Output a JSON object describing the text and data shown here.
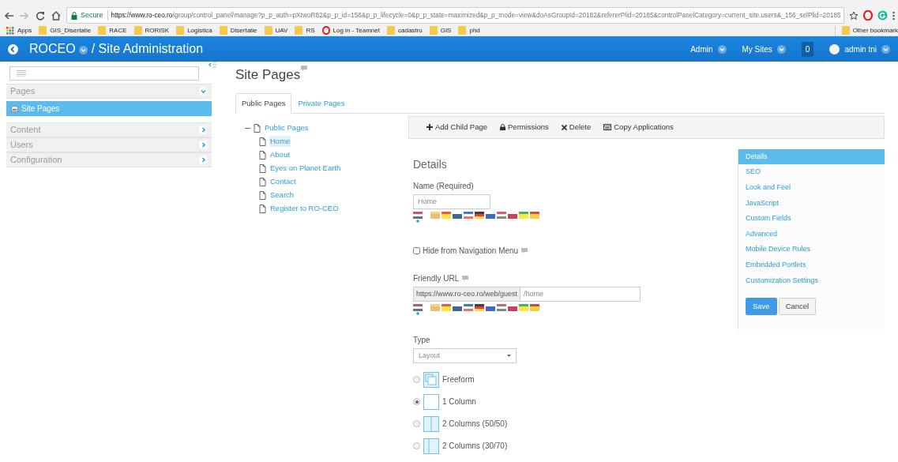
{
  "browser": {
    "nav": [
      {
        "kind": "back",
        "disabled": false
      },
      {
        "kind": "forward",
        "disabled": true
      },
      {
        "kind": "reload",
        "disabled": false
      },
      {
        "kind": "home",
        "disabled": false
      }
    ],
    "security": "Secure",
    "url_host": "https://www.ro-ceo.ro",
    "url_path": "/group/control_panel/manage?p_p_auth=pXtwoR82&p_p_id=156&p_p_lifecycle=0&p_p_state=maximized&p_p_mode=view&doAsGroupId=20182&refererPlid=20185&controlPanelCategory=current_site.users&_156_selPlid=20185",
    "bookmarks": [
      {
        "label": "Apps",
        "kind": "apps"
      },
      {
        "label": "GIS_Disertatie",
        "kind": "folder"
      },
      {
        "label": "RACE",
        "kind": "folder"
      },
      {
        "label": "RORISK",
        "kind": "folder"
      },
      {
        "label": "Logistica",
        "kind": "folder"
      },
      {
        "label": "Disertatie",
        "kind": "folder"
      },
      {
        "label": "UAV",
        "kind": "folder"
      },
      {
        "label": "RS",
        "kind": "folder"
      },
      {
        "label": "Log in - Teamnet",
        "kind": "opera"
      },
      {
        "label": "cadastru",
        "kind": "folder"
      },
      {
        "label": "GIS",
        "kind": "folder"
      },
      {
        "label": "phd",
        "kind": "folder"
      }
    ],
    "other_bookmarks": "Other bookmark"
  },
  "header": {
    "site": "ROCEO",
    "title": "/ Site Administration",
    "menus": [
      {
        "label": "Admin",
        "kind": "menu"
      },
      {
        "label": "My Sites",
        "kind": "menu"
      },
      {
        "label": "0",
        "kind": "count"
      },
      {
        "label": "admin tni",
        "kind": "user"
      }
    ]
  },
  "sidebar": {
    "panels": [
      {
        "label": "Pages",
        "expanded": true,
        "items": [
          {
            "label": "Site Pages",
            "selected": true
          }
        ]
      },
      {
        "label": "Content",
        "expanded": false
      },
      {
        "label": "Users",
        "expanded": false
      },
      {
        "label": "Configuration",
        "expanded": false
      }
    ]
  },
  "page": {
    "title": "Site Pages",
    "tabs": [
      {
        "label": "Public Pages",
        "selected": true
      },
      {
        "label": "Private Pages",
        "selected": false
      }
    ],
    "tree": {
      "label": "Public Pages",
      "expanded": true,
      "children": [
        {
          "label": "Home",
          "selected": true
        },
        {
          "label": "About",
          "selected": false
        },
        {
          "label": "Eyes on Planet Earth",
          "selected": false
        },
        {
          "label": "Contact",
          "selected": false
        },
        {
          "label": "Search",
          "selected": false
        },
        {
          "label": "Register to RO-CEO",
          "selected": false
        }
      ]
    },
    "toolbar": [
      {
        "label": "Add Child Page",
        "kind": "add"
      },
      {
        "label": "Permissions",
        "kind": "lock"
      },
      {
        "label": "Delete",
        "kind": "delete"
      },
      {
        "label": "Copy Applications",
        "kind": "copy"
      }
    ],
    "form": {
      "heading": "Details",
      "name_label": "Name (Required)",
      "name_value": "Home",
      "name_languages": [
        {
          "selected": true
        },
        {
          "selected": false
        },
        {
          "selected": false
        },
        {
          "selected": false
        },
        {
          "selected": false
        },
        {
          "selected": false
        },
        {
          "selected": false
        },
        {
          "selected": false
        },
        {
          "selected": false
        },
        {
          "selected": false
        },
        {
          "selected": false
        }
      ],
      "hide_label": "Hide from Navigation Menu",
      "hide_checked": false,
      "url_label": "Friendly URL",
      "url_prefix": "https://www.ro-ceo.ro/web/guest",
      "url_value": "/home",
      "url_languages": [
        {
          "selected": true
        },
        {
          "selected": false
        },
        {
          "selected": false
        },
        {
          "selected": false
        },
        {
          "selected": false
        },
        {
          "selected": false
        },
        {
          "selected": false
        },
        {
          "selected": false
        },
        {
          "selected": false
        },
        {
          "selected": false
        },
        {
          "selected": false
        }
      ],
      "type_label": "Type",
      "type_value": "Layout",
      "layouts": [
        {
          "label": "Freeform",
          "kind": "freeform",
          "selected": false
        },
        {
          "label": "1 Column",
          "kind": "one",
          "selected": true
        },
        {
          "label": "2 Columns (50/50)",
          "kind": "half",
          "selected": false
        },
        {
          "label": "2 Columns (30/70)",
          "kind": "thirty",
          "selected": false
        }
      ]
    },
    "nav": [
      {
        "label": "Details",
        "selected": true
      },
      {
        "label": "SEO",
        "selected": false
      },
      {
        "label": "Look and Feel",
        "selected": false
      },
      {
        "label": "JavaScript",
        "selected": false
      },
      {
        "label": "Custom Fields",
        "selected": false
      },
      {
        "label": "Advanced",
        "selected": false
      },
      {
        "label": "Mobile Device Rules",
        "selected": false
      },
      {
        "label": "Embedded Portlets",
        "selected": false
      },
      {
        "label": "Customization Settings",
        "selected": false
      }
    ],
    "buttons": [
      {
        "label": "Save",
        "kind": "primary"
      },
      {
        "label": "Cancel",
        "kind": "secondary"
      }
    ]
  }
}
